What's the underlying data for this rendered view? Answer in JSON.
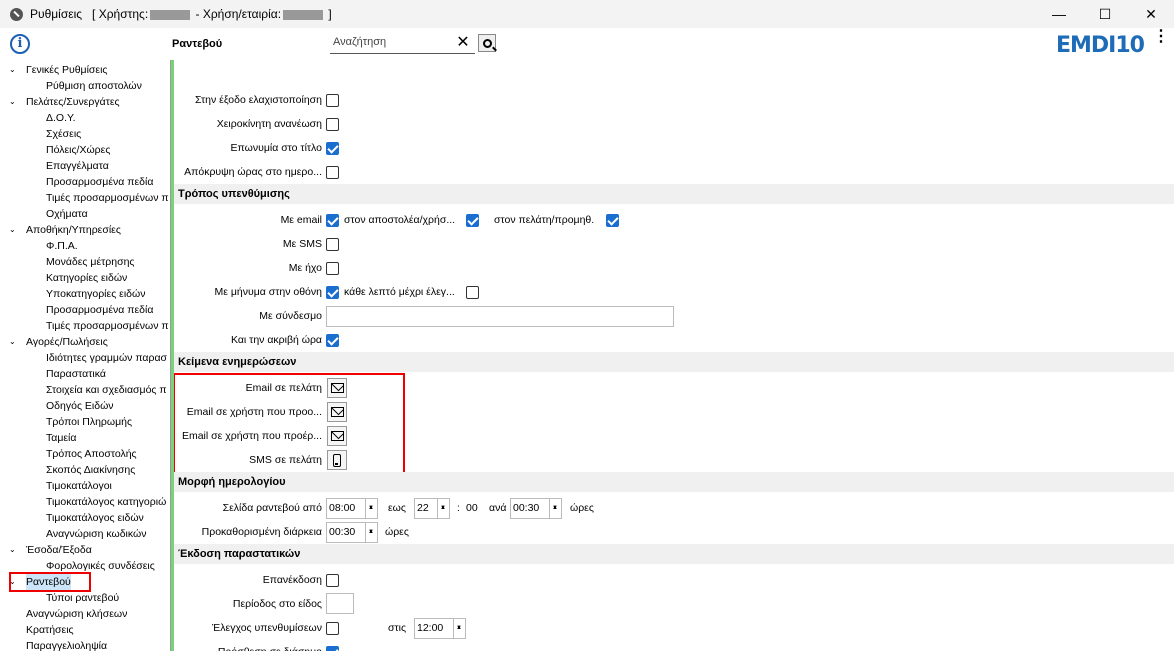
{
  "window": {
    "title": "Ρυθμίσεις",
    "title_user_prefix": "[ Χρήστης:",
    "title_company_prefix": "- Χρήση/εταιρία:",
    "title_suffix": "]",
    "minimize": "—",
    "maximize": "☐",
    "close": "✕"
  },
  "header": {
    "page_title": "Ραντεβού",
    "search_placeholder": "Αναζήτηση",
    "clear": "✕",
    "logo": "EMDI10",
    "more": "⋮"
  },
  "tree": [
    {
      "label": "Γενικές Ρυθμίσεις",
      "level": 0,
      "toggle": "⌄"
    },
    {
      "label": "Ρύθμιση αποστολών",
      "level": 1
    },
    {
      "label": "Πελάτες/Συνεργάτες",
      "level": 0,
      "toggle": "⌄"
    },
    {
      "label": "Δ.Ο.Υ.",
      "level": 1
    },
    {
      "label": "Σχέσεις",
      "level": 1
    },
    {
      "label": "Πόλεις/Χώρες",
      "level": 1
    },
    {
      "label": "Επαγγέλματα",
      "level": 1
    },
    {
      "label": "Προσαρμοσμένα πεδία",
      "level": 1
    },
    {
      "label": "Τιμές προσαρμοσμένων π",
      "level": 1
    },
    {
      "label": "Οχήματα",
      "level": 1
    },
    {
      "label": "Αποθήκη/Υπηρεσίες",
      "level": 0,
      "toggle": "⌄"
    },
    {
      "label": "Φ.Π.Α.",
      "level": 1
    },
    {
      "label": "Μονάδες μέτρησης",
      "level": 1
    },
    {
      "label": "Κατηγορίες ειδών",
      "level": 1
    },
    {
      "label": "Υποκατηγορίες ειδών",
      "level": 1
    },
    {
      "label": "Προσαρμοσμένα πεδία",
      "level": 1
    },
    {
      "label": "Τιμές προσαρμοσμένων π",
      "level": 1
    },
    {
      "label": "Αγορές/Πωλήσεις",
      "level": 0,
      "toggle": "⌄"
    },
    {
      "label": "Ιδιότητες γραμμών παρασ",
      "level": 1
    },
    {
      "label": "Παραστατικά",
      "level": 1
    },
    {
      "label": "Στοιχεία και σχεδιασμός π",
      "level": 1
    },
    {
      "label": "Οδηγός Ειδών",
      "level": 1
    },
    {
      "label": "Τρόποι Πληρωμής",
      "level": 1
    },
    {
      "label": "Ταμεία",
      "level": 1
    },
    {
      "label": "Τρόπος Αποστολής",
      "level": 1
    },
    {
      "label": "Σκοπός Διακίνησης",
      "level": 1
    },
    {
      "label": "Τιμοκατάλογοι",
      "level": 1
    },
    {
      "label": "Τιμοκατάλογος κατηγοριώ",
      "level": 1
    },
    {
      "label": "Τιμοκατάλογος ειδών",
      "level": 1
    },
    {
      "label": "Αναγνώριση κωδικών",
      "level": 1
    },
    {
      "label": "Έσοδα/Έξοδα",
      "level": 0,
      "toggle": "⌄"
    },
    {
      "label": "Φορολογικές συνδέσεις",
      "level": 1
    },
    {
      "label": "Ραντεβού",
      "level": 0,
      "toggle": "⌄",
      "selected": true
    },
    {
      "label": "Τύποι ραντεβού",
      "level": 1
    },
    {
      "label": "Αναγνώριση κλήσεων",
      "level": 0
    },
    {
      "label": "Κρατήσεις",
      "level": 0
    },
    {
      "label": "Παραγγελιοληψία",
      "level": 0
    }
  ],
  "general": {
    "minimize_on_exit": "Στην έξοδο ελαχιστοποίηση",
    "manual_refresh": "Χειροκίνητη ανανέωση",
    "name_in_title": "Επωνυμία στο τίτλο",
    "hide_time": "Απόκρυψη ώρας στο ημερο..."
  },
  "reminder": {
    "section": "Τρόπος υπενθύμισης",
    "by_email": "Με email",
    "to_sender": "στον αποστολέα/χρήσ...",
    "to_customer": "στον πελάτη/προμηθ.",
    "by_sms": "Με SMS",
    "by_sound": "Με ήχο",
    "by_screen": "Με μήνυμα στην οθόνη",
    "every_minute": "κάθε λεπτό μέχρι έλεγ...",
    "by_link": "Με σύνδεσμο",
    "link_value": "",
    "exact_time": "Και την ακριβή ώρα"
  },
  "texts": {
    "section": "Κείμενα ενημερώσεων",
    "email_customer": "Email σε πελάτη",
    "email_user_1": "Email σε χρήστη που προο...",
    "email_user_2": "Email σε χρήστη που προέρ...",
    "sms_customer": "SMS σε πελάτη"
  },
  "calendar": {
    "section": "Μορφή ημερολογίου",
    "page_from": "Σελίδα ραντεβού από",
    "from_value": "08:00",
    "until": "εως",
    "until_hour": "22",
    "colon": ":",
    "until_min": "00",
    "per": "ανά",
    "per_value": "00:30",
    "hours": "ώρες",
    "default_duration": "Προκαθορισμένη διάρκεια",
    "duration_value": "00:30",
    "hours2": "ώρες"
  },
  "issue": {
    "section": "Έκδοση παραστατικών",
    "reissue": "Επανέκδοση",
    "period_in_item": "Περίοδος στο είδος",
    "period_value": "",
    "check_reminders": "Έλεγχος υπενθυμίσεων",
    "at": "στις",
    "at_value": "12:00",
    "last_row": "Πρόσθεση σε διάσημο"
  },
  "colors": {
    "accent": "#1a6ecf",
    "highlight": "#e00000",
    "green_bar": "#79d279"
  }
}
